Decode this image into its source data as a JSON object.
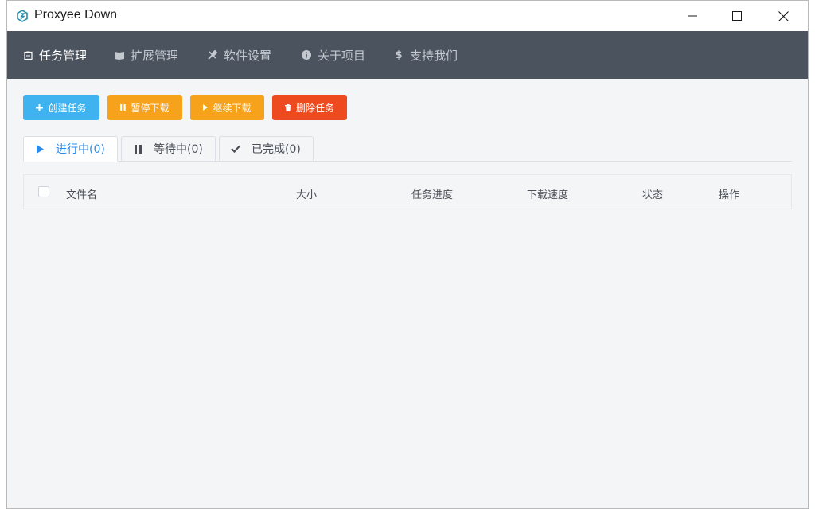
{
  "window": {
    "title": "Proxyee Down"
  },
  "nav": {
    "items": [
      {
        "label": "任务管理",
        "icon": "clipboard-icon",
        "active": true
      },
      {
        "label": "扩展管理",
        "icon": "puzzle-icon",
        "active": false
      },
      {
        "label": "软件设置",
        "icon": "tools-icon",
        "active": false
      },
      {
        "label": "关于项目",
        "icon": "info-icon",
        "active": false
      },
      {
        "label": "支持我们",
        "icon": "dollar-icon",
        "active": false
      }
    ]
  },
  "toolbar": {
    "create_label": "创建任务",
    "pause_label": "暂停下载",
    "resume_label": "继续下载",
    "delete_label": "删除任务"
  },
  "tabs": [
    {
      "label": "进行中(0)",
      "icon": "play-icon",
      "active": true
    },
    {
      "label": "等待中(0)",
      "icon": "pause-icon",
      "active": false
    },
    {
      "label": "已完成(0)",
      "icon": "check-icon",
      "active": false
    }
  ],
  "table": {
    "columns": [
      "文件名",
      "大小",
      "任务进度",
      "下载速度",
      "状态",
      "操作"
    ]
  },
  "colors": {
    "nav_bg": "#4b535f",
    "create": "#3fb3f0",
    "pause": "#f7a21b",
    "resume": "#f7a21b",
    "delete": "#ee4a1f",
    "tab_active": "#2b8be6"
  }
}
